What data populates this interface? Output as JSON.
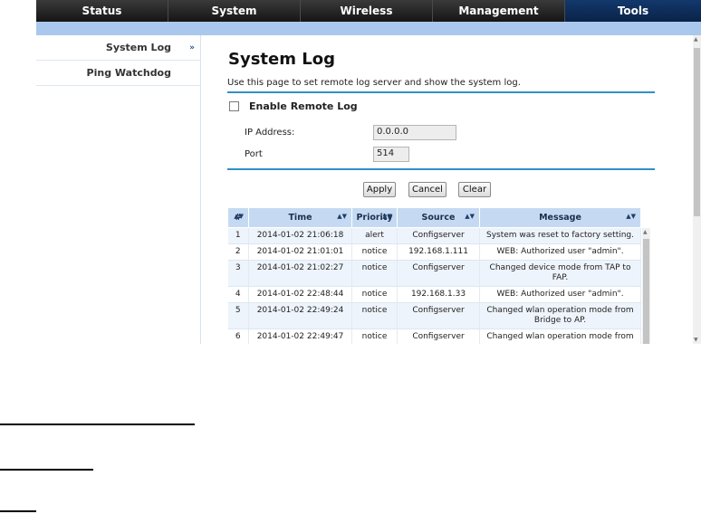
{
  "nav": {
    "tabs": [
      "Status",
      "System",
      "Wireless",
      "Management",
      "Tools"
    ],
    "active_tab": "Tools"
  },
  "sidebar": {
    "items": [
      "System Log",
      "Ping Watchdog"
    ],
    "active_item": "System Log"
  },
  "page": {
    "title": "System Log",
    "description": "Use this page to set remote log server and show the system log.",
    "enable_remote_label": "Enable Remote Log",
    "enable_remote_checked": false,
    "ip_label": "IP Address:",
    "ip_value": "0.0.0.0",
    "port_label": "Port",
    "port_value": "514"
  },
  "buttons": {
    "apply": "Apply",
    "cancel": "Cancel",
    "clear": "Clear"
  },
  "log_table": {
    "headers": [
      "#",
      "Time",
      "Priority",
      "Source",
      "Message"
    ],
    "rows": [
      {
        "num": "1",
        "time": "2014-01-02 21:06:18",
        "priority": "alert",
        "source": "Configserver",
        "message": "System was reset to factory setting."
      },
      {
        "num": "2",
        "time": "2014-01-02 21:01:01",
        "priority": "notice",
        "source": "192.168.1.111",
        "message": "WEB: Authorized user \"admin\"."
      },
      {
        "num": "3",
        "time": "2014-01-02 21:02:27",
        "priority": "notice",
        "source": "Configserver",
        "message": "Changed device mode from TAP to FAP."
      },
      {
        "num": "4",
        "time": "2014-01-02 22:48:44",
        "priority": "notice",
        "source": "192.168.1.33",
        "message": "WEB: Authorized user \"admin\"."
      },
      {
        "num": "5",
        "time": "2014-01-02 22:49:24",
        "priority": "notice",
        "source": "Configserver",
        "message": "Changed wlan operation mode from Bridge to AP."
      },
      {
        "num": "6",
        "time": "2014-01-02 22:49:47",
        "priority": "notice",
        "source": "Configserver",
        "message": "Changed wlan operation mode from"
      }
    ]
  },
  "icons": {
    "sort": "sort-icon",
    "sidebar_arrow": "double-chevron-right-icon",
    "checkbox": "checkbox-icon"
  },
  "colors": {
    "nav_bg": "#222222",
    "nav_active": "#12386c",
    "band": "#aac8ee",
    "rule": "#2e90c8",
    "table_header": "#c5daf2",
    "row_alt": "#eef4fb"
  }
}
